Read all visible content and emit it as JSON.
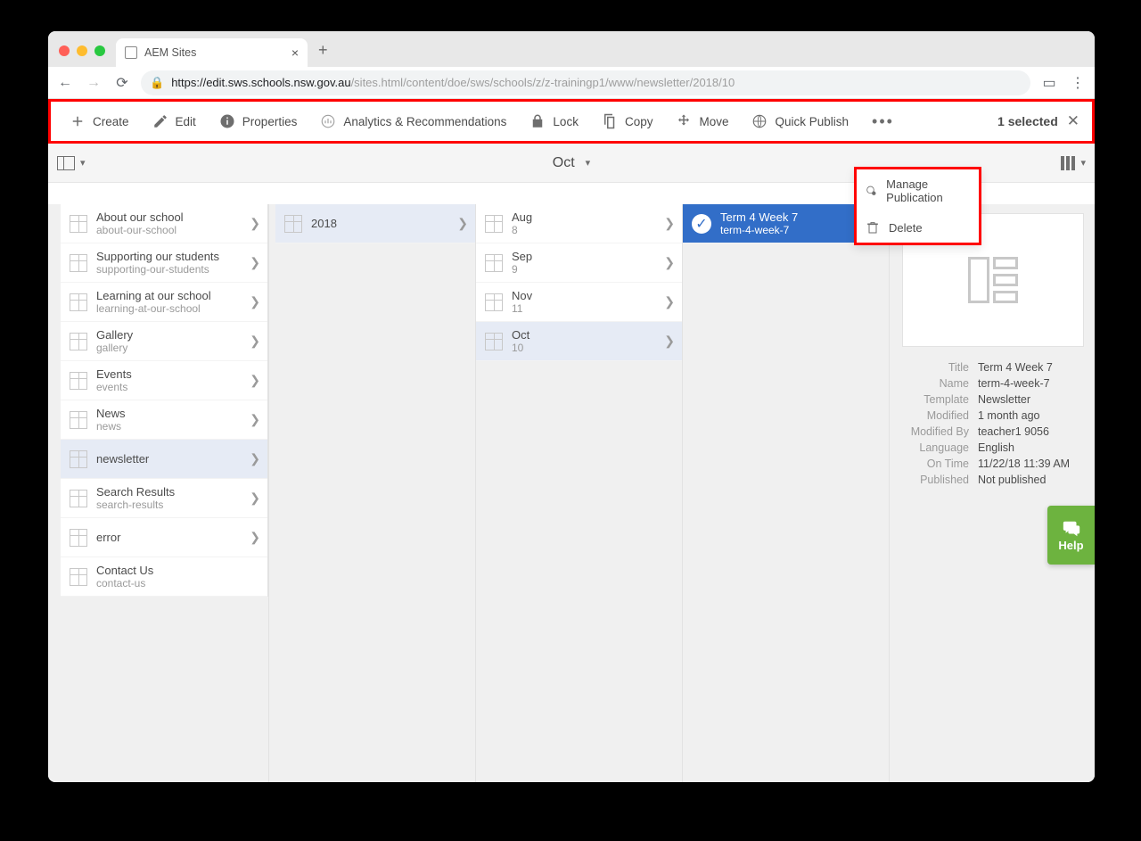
{
  "tab": {
    "title": "AEM Sites"
  },
  "url": {
    "host": "https://edit.sws.schools.nsw.gov.au",
    "path": "/sites.html/content/doe/sws/schools/z/z-trainingp1/www/newsletter/2018/10"
  },
  "actions": {
    "create": "Create",
    "edit": "Edit",
    "properties": "Properties",
    "analytics": "Analytics & Recommendations",
    "lock": "Lock",
    "copy": "Copy",
    "move": "Move",
    "quick_publish": "Quick Publish",
    "selected": "1 selected"
  },
  "overflow": {
    "manage_pub": "Manage Publication",
    "delete": "Delete"
  },
  "breadcrumb": "Oct",
  "col1": [
    {
      "t": "About our school",
      "s": "about-our-school"
    },
    {
      "t": "Supporting our students",
      "s": "supporting-our-students"
    },
    {
      "t": "Learning at our school",
      "s": "learning-at-our-school"
    },
    {
      "t": "Gallery",
      "s": "gallery"
    },
    {
      "t": "Events",
      "s": "events"
    },
    {
      "t": "News",
      "s": "news"
    },
    {
      "t": "newsletter",
      "s": ""
    },
    {
      "t": "Search Results",
      "s": "search-results"
    },
    {
      "t": "error",
      "s": ""
    },
    {
      "t": "Contact Us",
      "s": "contact-us"
    }
  ],
  "col2": [
    {
      "t": "2018",
      "s": ""
    }
  ],
  "col3": [
    {
      "t": "Aug",
      "s": "8"
    },
    {
      "t": "Sep",
      "s": "9"
    },
    {
      "t": "Nov",
      "s": "11"
    },
    {
      "t": "Oct",
      "s": "10"
    }
  ],
  "col4": [
    {
      "t": "Term 4 Week 7",
      "s": "term-4-week-7"
    }
  ],
  "details": {
    "title_k": "Title",
    "title_v": "Term 4 Week 7",
    "name_k": "Name",
    "name_v": "term-4-week-7",
    "template_k": "Template",
    "template_v": "Newsletter",
    "modified_k": "Modified",
    "modified_v": "1 month ago",
    "modifiedby_k": "Modified By",
    "modifiedby_v": "teacher1 9056",
    "language_k": "Language",
    "language_v": "English",
    "ontime_k": "On Time",
    "ontime_v": "11/22/18 11:39 AM",
    "published_k": "Published",
    "published_v": "Not published"
  },
  "help": "Help"
}
